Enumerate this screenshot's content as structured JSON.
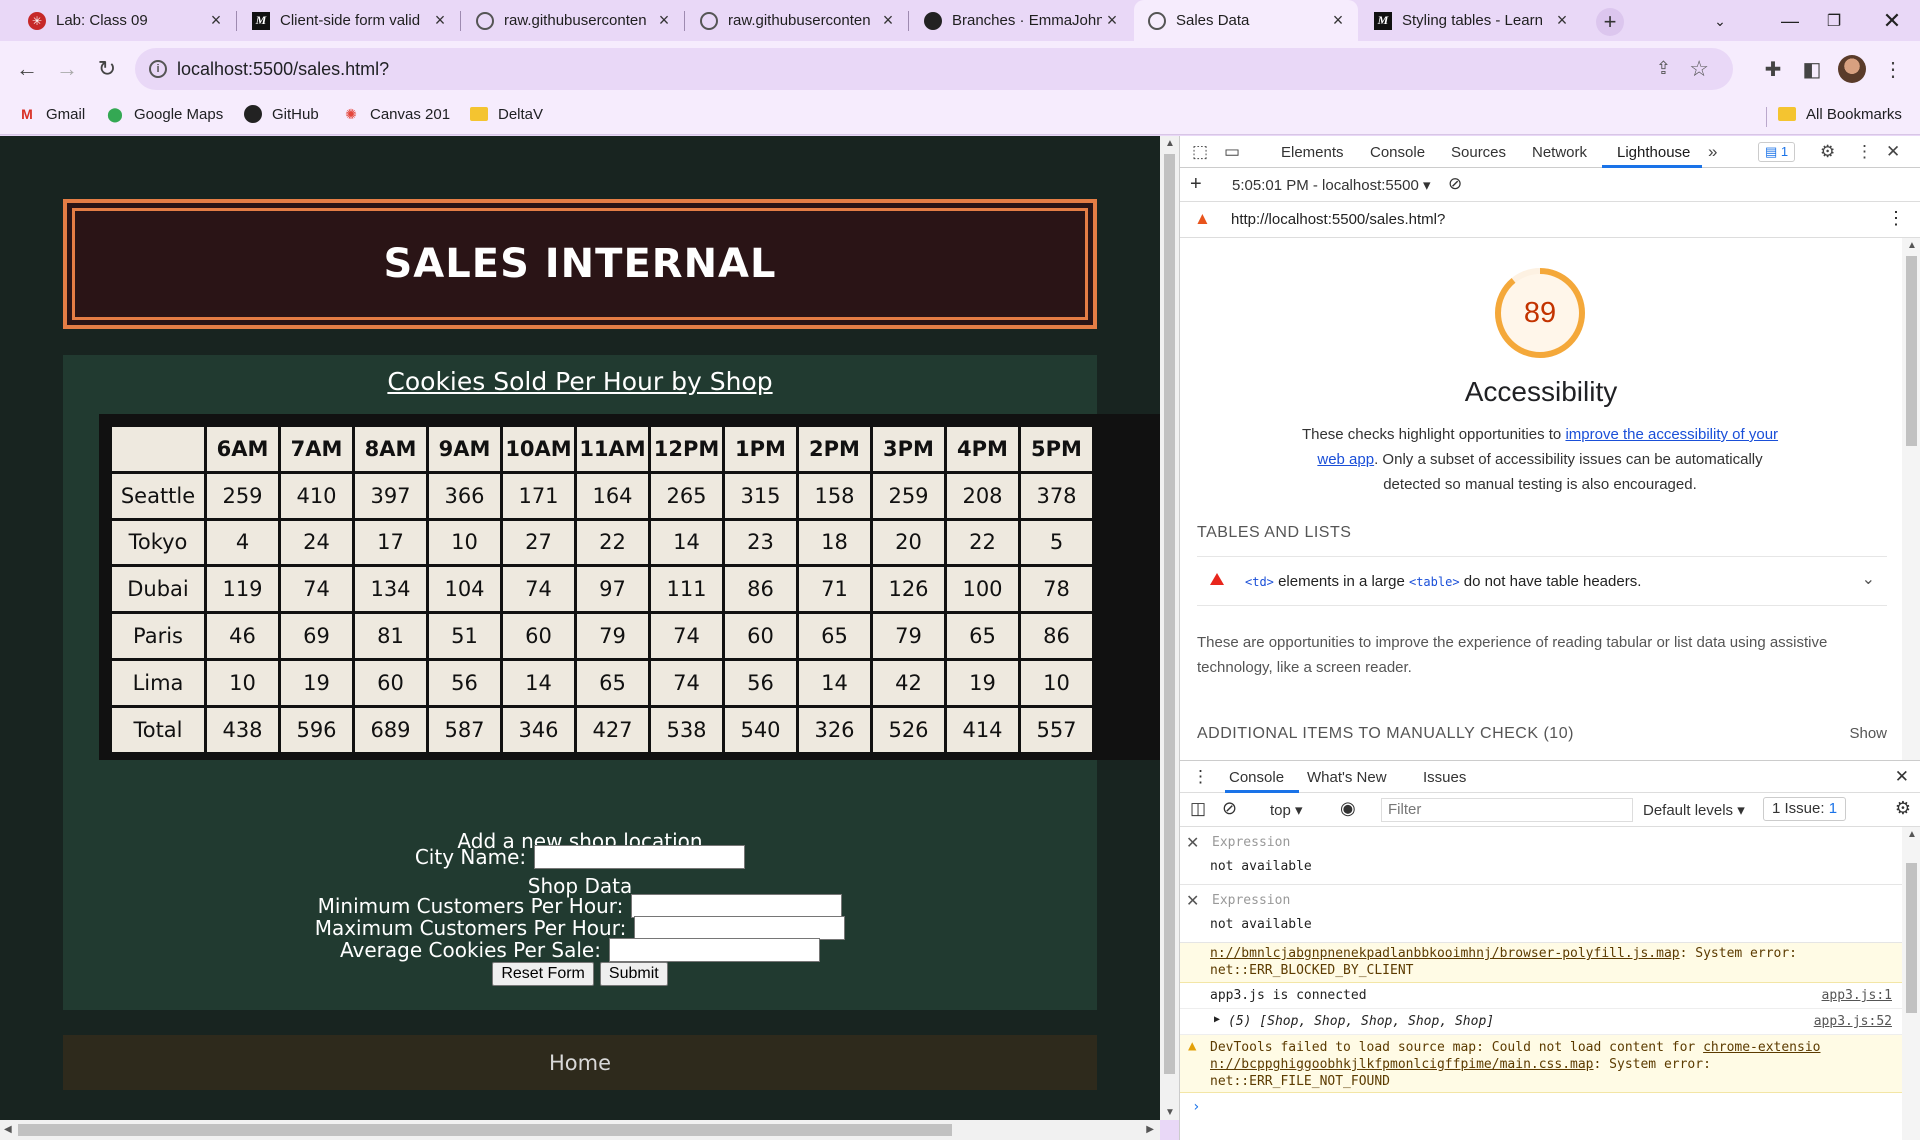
{
  "browser": {
    "tabs": [
      {
        "title": "Lab: Class 09",
        "icon": "lab-icon"
      },
      {
        "title": "Client-side form valid",
        "icon": "mdn-icon"
      },
      {
        "title": "raw.githubuserconten",
        "icon": "globe-icon"
      },
      {
        "title": "raw.githubuserconten",
        "icon": "globe-icon"
      },
      {
        "title": "Branches · EmmaJohn",
        "icon": "github-icon"
      },
      {
        "title": "Sales Data",
        "icon": "globe-icon"
      },
      {
        "title": "Styling tables - Learn",
        "icon": "mdn-icon"
      }
    ],
    "active_tab": 5,
    "url": "localhost:5500/sales.html?",
    "bookmarks": [
      "Gmail",
      "Google Maps",
      "GitHub",
      "Canvas 201",
      "DeltaV"
    ],
    "all_bookmarks": "All Bookmarks"
  },
  "page": {
    "title": "SALES INTERNAL",
    "table_title": "Cookies Sold Per Hour by Shop",
    "table": {
      "headers": [
        "",
        "6AM",
        "7AM",
        "8AM",
        "9AM",
        "10AM",
        "11AM",
        "12PM",
        "1PM",
        "2PM",
        "3PM",
        "4PM",
        "5PM"
      ],
      "rows": [
        [
          "Seattle",
          "259",
          "410",
          "397",
          "366",
          "171",
          "164",
          "265",
          "315",
          "158",
          "259",
          "208",
          "378"
        ],
        [
          "Tokyo",
          "4",
          "24",
          "17",
          "10",
          "27",
          "22",
          "14",
          "23",
          "18",
          "20",
          "22",
          "5"
        ],
        [
          "Dubai",
          "119",
          "74",
          "134",
          "104",
          "74",
          "97",
          "111",
          "86",
          "71",
          "126",
          "100",
          "78"
        ],
        [
          "Paris",
          "46",
          "69",
          "81",
          "51",
          "60",
          "79",
          "74",
          "60",
          "65",
          "79",
          "65",
          "86"
        ],
        [
          "Lima",
          "10",
          "19",
          "60",
          "56",
          "14",
          "65",
          "74",
          "56",
          "14",
          "42",
          "19",
          "10"
        ],
        [
          "Total",
          "438",
          "596",
          "689",
          "587",
          "346",
          "427",
          "538",
          "540",
          "326",
          "526",
          "414",
          "557"
        ]
      ]
    },
    "form": {
      "heading": "Add a new shop location",
      "city_label": "City Name:",
      "shop_data_label": "Shop Data",
      "min_label": "Minimum Customers Per Hour:",
      "max_label": "Maximum Customers Per Hour:",
      "avg_label": "Average Cookies Per Sale:",
      "reset_label": "Reset Form",
      "submit_label": "Submit"
    },
    "footer_link": "Home"
  },
  "devtools": {
    "tabs": [
      "Elements",
      "Console",
      "Sources",
      "Network",
      "Lighthouse"
    ],
    "active_tab": "Lighthouse",
    "issues_badge": "1",
    "report_selector": "5:05:01 PM - localhost:5500",
    "report_url": "http://localhost:5500/sales.html?",
    "score": 89,
    "category": "Accessibility",
    "desc_pre": "These checks highlight opportunities to ",
    "desc_link": "improve the accessibility of your web app",
    "desc_post": ". Only a subset of accessibility issues can be automatically detected so manual testing is also encouraged.",
    "group_title": "TABLES AND LISTS",
    "audit_code1": "<td>",
    "audit_mid": " elements in a large ",
    "audit_code2": "<table>",
    "audit_post": " do not have table headers.",
    "group_desc": "These are opportunities to improve the experience of reading tabular or list data using assistive technology, like a screen reader.",
    "manual_title": "ADDITIONAL ITEMS TO MANUALLY CHECK (10)",
    "manual_show": "Show",
    "drawer_tabs": [
      "Console",
      "What's New",
      "Issues"
    ],
    "context": "top",
    "filter_placeholder": "Filter",
    "levels": "Default levels",
    "issue_count": "1 Issue:",
    "issue_num": "1",
    "expressions": [
      {
        "label": "Expression",
        "value": "not available"
      },
      {
        "label": "Expression",
        "value": "not available"
      }
    ],
    "log": {
      "err1_line1_link": "n://bmnlcjabgnpnenekpadlanbbkooimhnj/browser-polyfill.js.map",
      "err1_line1_rest": ": System error:",
      "err1_line2": "net::ERR_BLOCKED_BY_CLIENT",
      "msg1": "app3.js is connected",
      "src1": "app3.js:1",
      "msg2": "(5) [Shop, Shop, Shop, Shop, Shop]",
      "src2": "app3.js:52",
      "warn_pre": "DevTools failed to load source map: Could not load content for ",
      "warn_link1": "chrome-extensio",
      "warn_link2": "n://bcppghiggoobhkjlkfpmonlcigffpime/main.css.map",
      "warn_rest": ": System error:",
      "warn_line3": "net::ERR_FILE_NOT_FOUND"
    }
  },
  "colors": {
    "page_bg": "#182420",
    "header_border": "#e47d45",
    "panel_bg": "#213a30",
    "score_ring": "#f4a83a",
    "link": "#1a4fd8"
  }
}
